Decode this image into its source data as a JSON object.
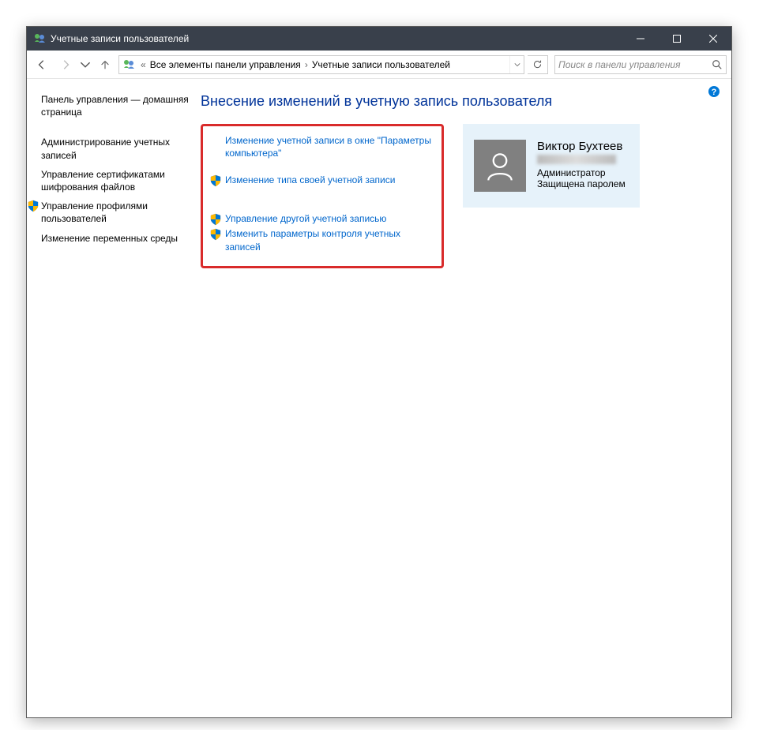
{
  "window": {
    "title": "Учетные записи пользователей"
  },
  "breadcrumb": {
    "prefix": "«",
    "item1": "Все элементы панели управления",
    "item2": "Учетные записи пользователей"
  },
  "search": {
    "placeholder": "Поиск в панели управления"
  },
  "sidebar": {
    "home": "Панель управления — домашняя страница",
    "admin": "Администрирование учетных записей",
    "certs": "Управление сертификатами шифрования файлов",
    "profiles": "Управление профилями пользователей",
    "env": "Изменение переменных среды"
  },
  "main": {
    "heading": "Внесение изменений в учетную запись пользователя",
    "link1": "Изменение учетной записи в окне \"Параметры компьютера\"",
    "link2": "Изменение типа своей учетной записи",
    "link3": "Управление другой учетной записью",
    "link4": "Изменить параметры контроля учетных записей"
  },
  "user": {
    "name": "Виктор Бухтеев",
    "role": "Администратор",
    "protection": "Защищена паролем"
  }
}
